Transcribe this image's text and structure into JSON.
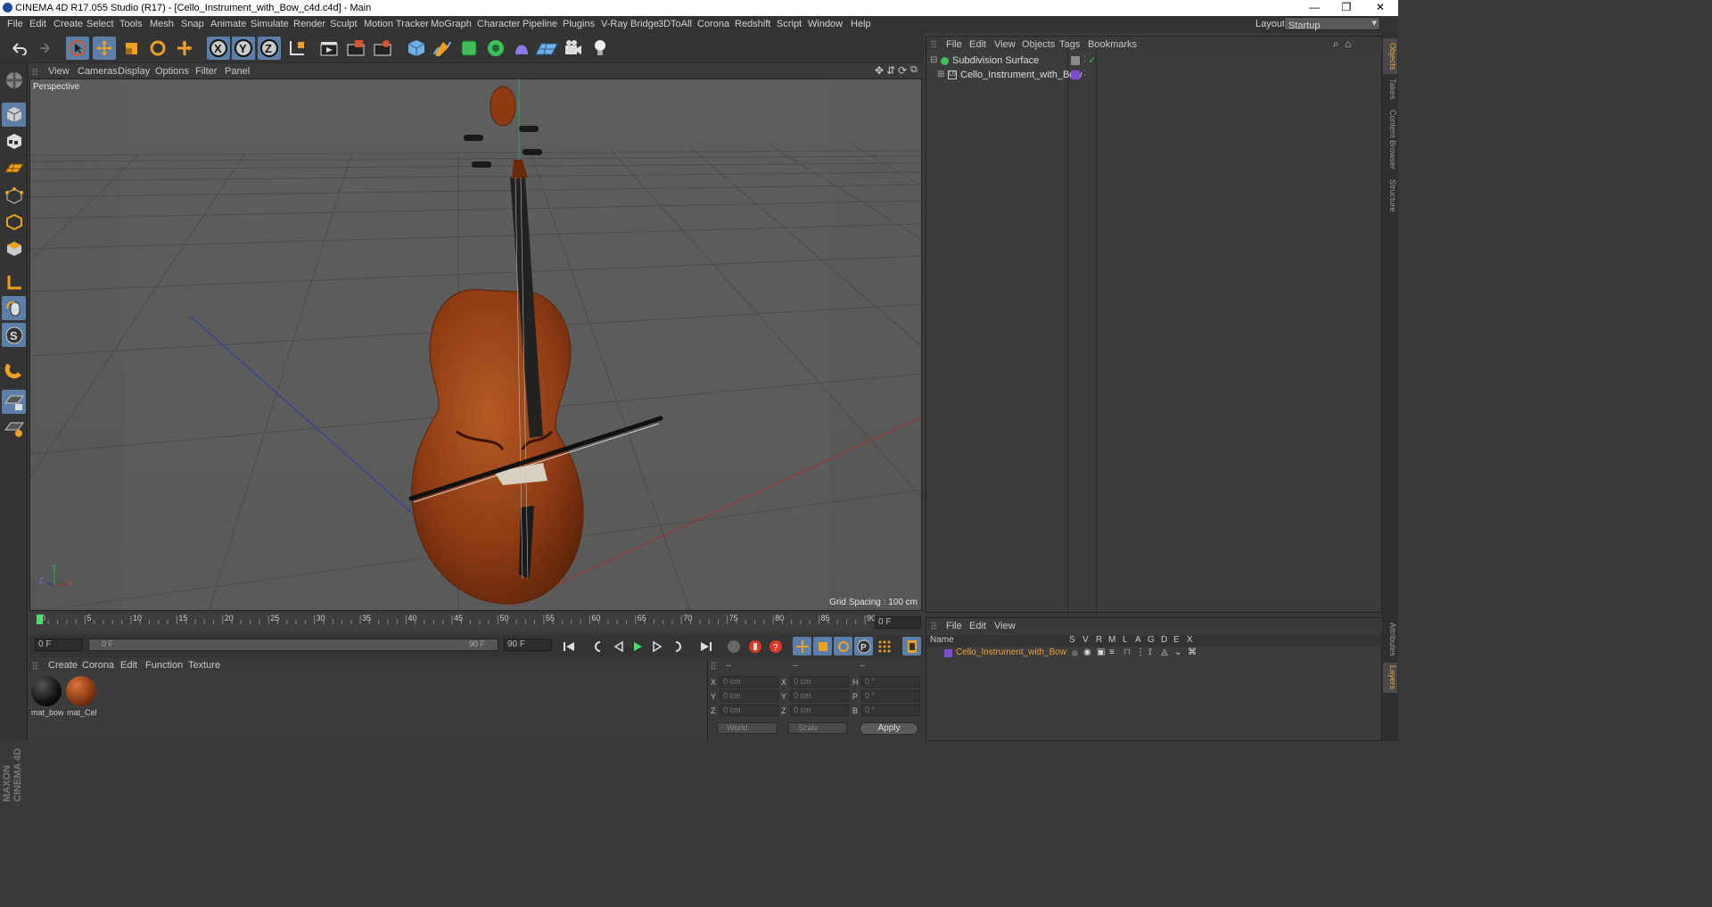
{
  "window": {
    "title": "CINEMA 4D R17.055 Studio (R17) - [Cello_Instrument_with_Bow_c4d.c4d] - Main",
    "minimize": "—",
    "restore": "❐",
    "close": "✕"
  },
  "menubar": {
    "items": [
      "File",
      "Edit",
      "Create",
      "Select",
      "Tools",
      "Mesh",
      "Snap",
      "Animate",
      "Simulate",
      "Render",
      "Sculpt",
      "Motion Tracker",
      "MoGraph",
      "Character",
      "Pipeline",
      "Plugins",
      "V-Ray Bridge",
      "3DToAll",
      "Corona",
      "Redshift",
      "Script",
      "Window",
      "Help"
    ],
    "layout_label": "Layout:",
    "layout_value": "Startup"
  },
  "toolbar": {
    "axis_x": "X",
    "axis_y": "Y",
    "axis_z": "Z"
  },
  "viewport": {
    "menu": [
      "View",
      "Cameras",
      "Display",
      "Options",
      "Filter",
      "Panel"
    ],
    "camera_label": "Perspective",
    "grid_spacing": "Grid Spacing : 100 cm",
    "axis_x": "X",
    "axis_y": "Y",
    "axis_z": "Z"
  },
  "timeline": {
    "ticks": [
      "0",
      "5",
      "10",
      "15",
      "20",
      "25",
      "30",
      "35",
      "40",
      "45",
      "50",
      "55",
      "60",
      "65",
      "70",
      "75",
      "80",
      "85",
      "90"
    ],
    "current_frame": "0 F",
    "start_field": "0 F",
    "range_start": "0 F",
    "range_end": "90 F",
    "end_field": "90 F"
  },
  "material_manager": {
    "menu": [
      "Create",
      "Corona",
      "Edit",
      "Function",
      "Texture"
    ],
    "materials": [
      {
        "name": "mat_bow"
      },
      {
        "name": "mat_Cel"
      }
    ]
  },
  "coordinates": {
    "headers": [
      "--",
      "--",
      "--"
    ],
    "rows": [
      {
        "l1": "X",
        "v1": "0 cm",
        "l2": "X",
        "v2": "0 cm",
        "l3": "H",
        "v3": "0 °"
      },
      {
        "l1": "Y",
        "v1": "0 cm",
        "l2": "Y",
        "v2": "0 cm",
        "l3": "P",
        "v3": "0 °"
      },
      {
        "l1": "Z",
        "v1": "0 cm",
        "l2": "Z",
        "v2": "0 cm",
        "l3": "B",
        "v3": "0 °"
      }
    ],
    "space": "World",
    "mode": "Scale",
    "apply": "Apply"
  },
  "object_manager": {
    "menu": [
      "File",
      "Edit",
      "View",
      "Objects",
      "Tags",
      "Bookmarks"
    ],
    "objects": [
      {
        "name": "Subdivision Surface"
      },
      {
        "name": "Cello_Instrument_with_Bow"
      }
    ]
  },
  "layer_manager": {
    "menu": [
      "File",
      "Edit",
      "View"
    ],
    "columns": [
      "Name",
      "S",
      "V",
      "R",
      "M",
      "L",
      "A",
      "G",
      "D",
      "E",
      "X"
    ],
    "layers": [
      {
        "name": "Cello_Instrument_with_Bow",
        "color": "#7b4bd6"
      }
    ]
  },
  "right_tabs": [
    "Objects",
    "Takes",
    "Content Browser",
    "Structure",
    "Attributes",
    "Layers"
  ],
  "brand": {
    "text": "MAXON CINEMA 4D"
  },
  "colors": {
    "accent": "#5b7fa8",
    "highlight": "#e8a33a",
    "cello": "#8a3a14"
  }
}
